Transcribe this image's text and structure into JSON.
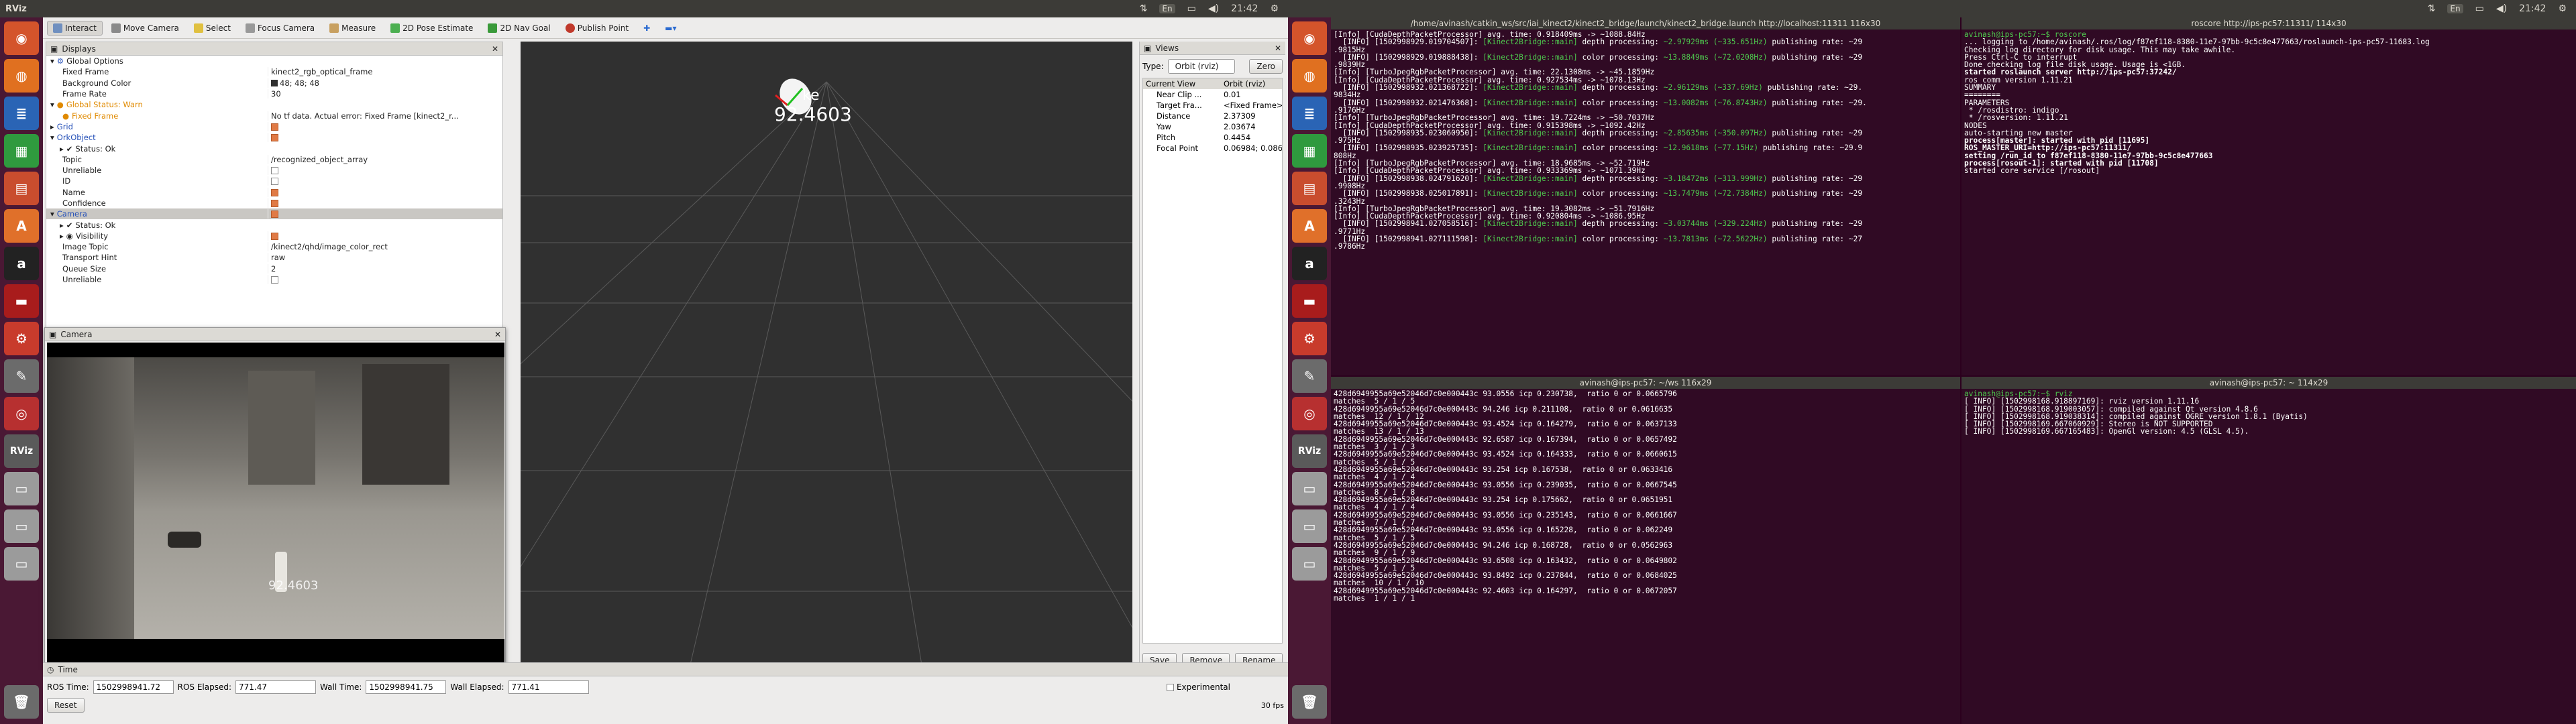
{
  "topbar": {
    "rviz_title": "RViz",
    "tray_left": {
      "lang": "En",
      "time": "21:42"
    },
    "tray_right": {
      "lang": "En",
      "time": "21:42"
    }
  },
  "rviz": {
    "toolbar": [
      "Interact",
      "Move Camera",
      "Select",
      "Focus Camera",
      "Measure",
      "2D Pose Estimate",
      "2D Nav Goal",
      "Publish Point"
    ],
    "displays_title": "Displays",
    "displays": [
      {
        "name": "Global Options",
        "value": "",
        "indent": 1,
        "expand": "v",
        "icon": "gear"
      },
      {
        "name": "Fixed Frame",
        "value": "kinect2_rgb_optical_frame",
        "indent": 2
      },
      {
        "name": "Background Color",
        "value": "48; 48; 48",
        "indent": 2,
        "swatch": true
      },
      {
        "name": "Frame Rate",
        "value": "30",
        "indent": 2
      },
      {
        "name": "Global Status: Warn",
        "value": "",
        "indent": 1,
        "expand": "v",
        "cls": "warn",
        "icon": "warn"
      },
      {
        "name": "Fixed Frame",
        "value": "No tf data.  Actual error: Fixed Frame [kinect2_r...",
        "indent": 2,
        "cls": "warn",
        "icon": "warn"
      },
      {
        "name": "Grid",
        "value": "",
        "indent": 1,
        "expand": ">",
        "cls": "blue",
        "check": true
      },
      {
        "name": "OrkObject",
        "value": "",
        "indent": 1,
        "expand": "v",
        "cls": "blue",
        "check": true
      },
      {
        "name": "Status: Ok",
        "value": "",
        "indent": 2,
        "expand": ">",
        "icon": "ok"
      },
      {
        "name": "Topic",
        "value": "/recognized_object_array",
        "indent": 2
      },
      {
        "name": "Unreliable",
        "value": "",
        "indent": 2,
        "check": false
      },
      {
        "name": "ID",
        "value": "",
        "indent": 2,
        "check": false
      },
      {
        "name": "Name",
        "value": "",
        "indent": 2,
        "check": true
      },
      {
        "name": "Confidence",
        "value": "",
        "indent": 2,
        "check": true
      },
      {
        "name": "Camera",
        "value": "",
        "indent": 1,
        "expand": "v",
        "cls": "blue",
        "check": true,
        "sel": true
      },
      {
        "name": "Status: Ok",
        "value": "",
        "indent": 2,
        "expand": ">",
        "icon": "ok"
      },
      {
        "name": "Visibility",
        "value": "",
        "indent": 2,
        "expand": ">",
        "icon": "eye",
        "check": true
      },
      {
        "name": "Image Topic",
        "value": "/kinect2/qhd/image_color_rect",
        "indent": 2
      },
      {
        "name": "Transport Hint",
        "value": "raw",
        "indent": 2
      },
      {
        "name": "Queue Size",
        "value": "2",
        "indent": 2
      },
      {
        "name": "Unreliable",
        "value": "",
        "indent": 2,
        "check": false
      }
    ],
    "camera_title": "Camera",
    "camera_overlay": "92.4603",
    "viewport_label": "92.4603",
    "viewport_label_small": "ke",
    "views": {
      "title": "Views",
      "type_label": "Type:",
      "type_value": "Orbit (rviz)",
      "zero": "Zero",
      "current_view": "Current View",
      "current_view_type": "Orbit (rviz)",
      "props": [
        {
          "k": "Near Clip ...",
          "v": "0.01"
        },
        {
          "k": "Target Fra...",
          "v": "<Fixed Frame>"
        },
        {
          "k": "Distance",
          "v": "2.37309"
        },
        {
          "k": "Yaw",
          "v": "2.03674"
        },
        {
          "k": "Pitch",
          "v": "0.4454"
        },
        {
          "k": "Focal Point",
          "v": "0.06984; 0.08633..."
        }
      ],
      "buttons": [
        "Save",
        "Remove",
        "Rename"
      ]
    },
    "time": {
      "title": "Time",
      "ros_time_label": "ROS Time:",
      "ros_time": "1502998941.72",
      "ros_elapsed_label": "ROS Elapsed:",
      "ros_elapsed": "771.47",
      "wall_time_label": "Wall Time:",
      "wall_time": "1502998941.75",
      "wall_elapsed_label": "Wall Elapsed:",
      "wall_elapsed": "771.41",
      "experimental": "Experimental",
      "reset": "Reset",
      "fps": "30 fps"
    }
  },
  "terminals": {
    "t1": {
      "title": "/home/avinash/catkin_ws/src/iai_kinect2/kinect2_bridge/launch/kinect2_bridge.launch http://localhost:11311 116x30",
      "lines": [
        "[Info] [CudaDepthPacketProcessor] avg. time: 0.918409ms -> ~1088.84Hz",
        "  [INFO] [1502998929.019704507]: [Kinect2Bridge::main] depth processing: ~2.97929ms (~335.651Hz) publishing rate: ~29",
        ".9815Hz",
        "  [INFO] [1502998929.019888438]: [Kinect2Bridge::main] color processing: ~13.8849ms (~72.0208Hz) publishing rate: ~29",
        ".9839Hz",
        "[Info] [TurboJpegRgbPacketProcessor] avg. time: 22.1308ms -> ~45.1859Hz",
        "[Info] [CudaDepthPacketProcessor] avg. time: 0.927534ms -> ~1078.13Hz",
        "  [INFO] [1502998932.021368722]: [Kinect2Bridge::main] depth processing: ~2.96129ms (~337.69Hz) publishing rate: ~29.",
        "9834Hz",
        "  [INFO] [1502998932.021476368]: [Kinect2Bridge::main] color processing: ~13.0082ms (~76.8743Hz) publishing rate: ~29.",
        ".9176Hz",
        "[Info] [TurboJpegRgbPacketProcessor] avg. time: 19.7224ms -> ~50.7037Hz",
        "[Info] [CudaDepthPacketProcessor] avg. time: 0.915398ms -> ~1092.42Hz",
        "  [INFO] [1502998935.023060950]: [Kinect2Bridge::main] depth processing: ~2.85635ms (~350.097Hz) publishing rate: ~29",
        ".975Hz",
        "  [INFO] [1502998935.023925735]: [Kinect2Bridge::main] color processing: ~12.9618ms (~77.15Hz) publishing rate: ~29.9",
        "808Hz",
        "[Info] [TurboJpegRgbPacketProcessor] avg. time: 18.9685ms -> ~52.719Hz",
        "[Info] [CudaDepthPacketProcessor] avg. time: 0.933369ms -> ~1071.39Hz",
        "  [INFO] [1502998938.024791620]: [Kinect2Bridge::main] depth processing: ~3.18472ms (~313.999Hz) publishing rate: ~29",
        ".9908Hz",
        "  [INFO] [1502998938.025017891]: [Kinect2Bridge::main] color processing: ~13.7479ms (~72.7384Hz) publishing rate: ~29",
        ".3243Hz",
        "[Info] [TurboJpegRgbPacketProcessor] avg. time: 19.3082ms -> ~51.7916Hz",
        "[Info] [CudaDepthPacketProcessor] avg. time: 0.920804ms -> ~1086.95Hz",
        "  [INFO] [1502998941.027058516]: [Kinect2Bridge::main] depth processing: ~3.03744ms (~329.224Hz) publishing rate: ~29",
        ".9771Hz",
        "  [INFO] [1502998941.027111598]: [Kinect2Bridge::main] color processing: ~13.7813ms (~72.5622Hz) publishing rate: ~27",
        ".9786Hz"
      ]
    },
    "t2": {
      "title": "roscore http://ips-pc57:11311/ 114x30",
      "lines": [
        {
          "t": "avinash@ips-pc57:~$ roscore",
          "c": "green"
        },
        {
          "t": "... logging to /home/avinash/.ros/log/f87ef118-8380-11e7-97bb-9c5c8e477663/roslaunch-ips-pc57-11683.log",
          "c": ""
        },
        {
          "t": "Checking log directory for disk usage. This may take awhile.",
          "c": ""
        },
        {
          "t": "Press Ctrl-C to interrupt",
          "c": ""
        },
        {
          "t": "Done checking log file disk usage. Usage is <1GB.",
          "c": ""
        },
        {
          "t": "",
          "c": ""
        },
        {
          "t": "started roslaunch server http://ips-pc57:37242/",
          "c": "bold"
        },
        {
          "t": "ros_comm version 1.11.21",
          "c": ""
        },
        {
          "t": "",
          "c": ""
        },
        {
          "t": "",
          "c": ""
        },
        {
          "t": "SUMMARY",
          "c": ""
        },
        {
          "t": "========",
          "c": ""
        },
        {
          "t": "",
          "c": ""
        },
        {
          "t": "PARAMETERS",
          "c": ""
        },
        {
          "t": " * /rosdistro: indigo",
          "c": ""
        },
        {
          "t": " * /rosversion: 1.11.21",
          "c": ""
        },
        {
          "t": "",
          "c": ""
        },
        {
          "t": "NODES",
          "c": ""
        },
        {
          "t": "",
          "c": ""
        },
        {
          "t": "auto-starting new master",
          "c": ""
        },
        {
          "t": "process[master]: started with pid [11695]",
          "c": "bold"
        },
        {
          "t": "ROS_MASTER_URI=http://ips-pc57:11311/",
          "c": "bold"
        },
        {
          "t": "",
          "c": ""
        },
        {
          "t": "setting /run_id to f87ef118-8380-11e7-97bb-9c5c8e477663",
          "c": "bold"
        },
        {
          "t": "process[rosout-1]: started with pid [11708]",
          "c": "bold"
        },
        {
          "t": "started core service [/rosout]",
          "c": ""
        }
      ]
    },
    "t3": {
      "title": "avinash@ips-pc57: ~/ws 116x29",
      "lines": [
        "428d6949955a69e52046d7c0e000443c 93.0556 icp 0.230738,  ratio 0 or 0.0665796",
        "matches  5 / 1 / 5",
        "428d6949955a69e52046d7c0e000443c 94.246 icp 0.211108,  ratio 0 or 0.0616635",
        "matches  12 / 1 / 12",
        "428d6949955a69e52046d7c0e000443c 93.4524 icp 0.164279,  ratio 0 or 0.0637133",
        "matches  13 / 1 / 13",
        "428d6949955a69e52046d7c0e000443c 92.6587 icp 0.167394,  ratio 0 or 0.0657492",
        "matches  3 / 1 / 3",
        "428d6949955a69e52046d7c0e000443c 93.4524 icp 0.164333,  ratio 0 or 0.0660615",
        "matches  5 / 1 / 5",
        "428d6949955a69e52046d7c0e000443c 93.254 icp 0.167538,  ratio 0 or 0.0633416",
        "matches  4 / 1 / 4",
        "428d6949955a69e52046d7c0e000443c 93.0556 icp 0.239035,  ratio 0 or 0.0667545",
        "matches  8 / 1 / 8",
        "428d6949955a69e52046d7c0e000443c 93.254 icp 0.175662,  ratio 0 or 0.0651951",
        "matches  4 / 1 / 4",
        "428d6949955a69e52046d7c0e000443c 93.0556 icp 0.235143,  ratio 0 or 0.0661667",
        "matches  7 / 1 / 7",
        "428d6949955a69e52046d7c0e000443c 93.0556 icp 0.165228,  ratio 0 or 0.062249",
        "matches  5 / 1 / 5",
        "428d6949955a69e52046d7c0e000443c 94.246 icp 0.168728,  ratio 0 or 0.0562963",
        "matches  9 / 1 / 9",
        "428d6949955a69e52046d7c0e000443c 93.6508 icp 0.163432,  ratio 0 or 0.0649802",
        "matches  5 / 1 / 5",
        "428d6949955a69e52046d7c0e000443c 93.8492 icp 0.237844,  ratio 0 or 0.0684025",
        "matches  10 / 1 / 10",
        "428d6949955a69e52046d7c0e000443c 92.4603 icp 0.164297,  ratio 0 or 0.0672057",
        "matches  1 / 1 / 1"
      ]
    },
    "t4": {
      "title": "avinash@ips-pc57: ~ 114x29",
      "lines": [
        {
          "t": "avinash@ips-pc57:~$ rviz",
          "c": "green"
        },
        {
          "t": "[ INFO] [1502998168.918897169]: rviz version 1.11.16",
          "c": ""
        },
        {
          "t": "[ INFO] [1502998168.919003057]: compiled against Qt version 4.8.6",
          "c": ""
        },
        {
          "t": "[ INFO] [1502998168.919038314]: compiled against OGRE version 1.8.1 (Byatis)",
          "c": ""
        },
        {
          "t": "[ INFO] [1502998169.667060929]: Stereo is NOT SUPPORTED",
          "c": ""
        },
        {
          "t": "[ INFO] [1502998169.667165483]: OpenGl version: 4.5 (GLSL 4.5).",
          "c": ""
        }
      ]
    }
  }
}
